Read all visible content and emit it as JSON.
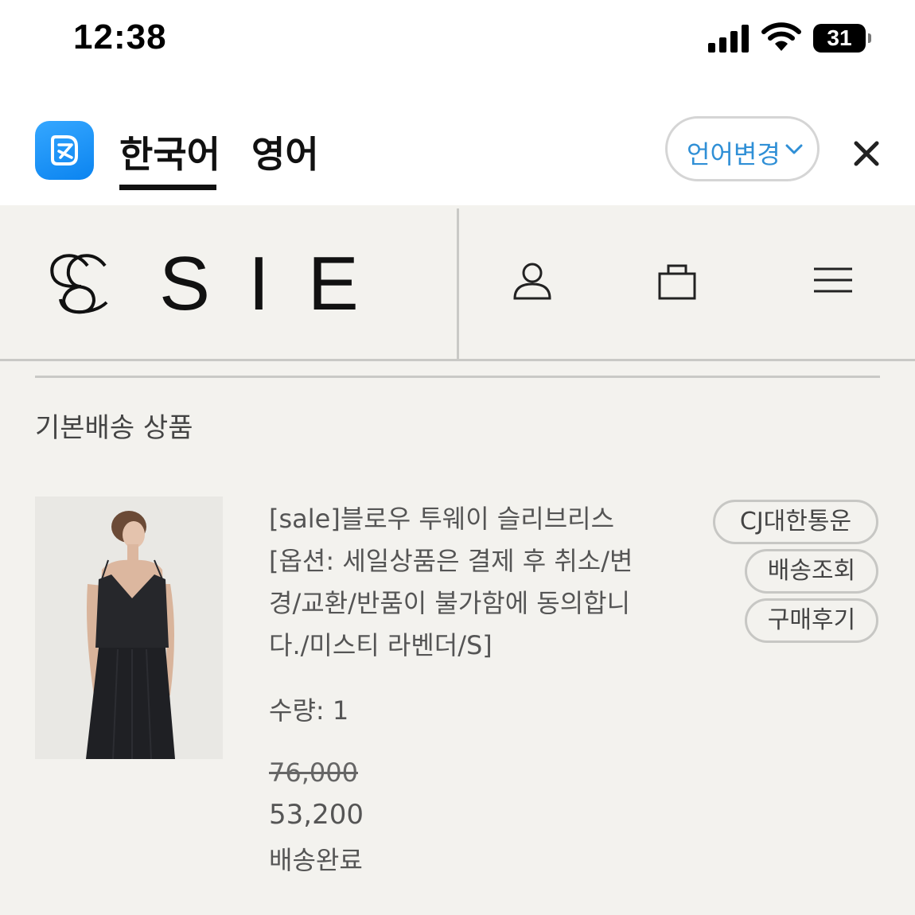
{
  "status_bar": {
    "time": "12:38",
    "battery": "31"
  },
  "translate_bar": {
    "tabs": [
      {
        "label": "한국어",
        "active": true
      },
      {
        "label": "영어",
        "active": false
      }
    ],
    "change_language_label": "언어변경"
  },
  "header": {
    "brand": "SIE"
  },
  "order": {
    "section_title": "기본배송 상품",
    "item": {
      "name": "[sale]블로우 투웨이 슬리브리스 [옵션: 세일상품은 결제 후 취소/변경/교환/반품이 불가함에 동의합니다./미스티 라벤더/S]",
      "quantity": "수량: 1",
      "original_price": "76,000",
      "sale_price": "53,200",
      "status": "배송완료"
    },
    "actions": {
      "courier": "CJ대한통운",
      "tracking": "배송조회",
      "review": "구매후기"
    }
  },
  "colors": {
    "page_bg": "#f3f2ee",
    "accent_blue": "#2f8fd6",
    "app_icon": "#1e96f8"
  }
}
